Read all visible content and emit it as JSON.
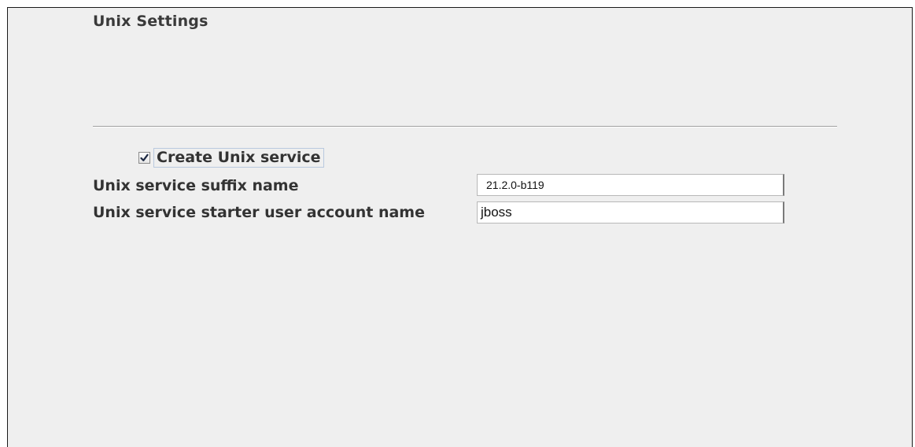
{
  "window": {
    "section_title": "Unix Settings"
  },
  "form": {
    "create_service": {
      "label": "Create Unix service",
      "checked": true
    },
    "suffix": {
      "label": "Unix service suffix name",
      "value": "21.2.0-b119"
    },
    "account": {
      "label": "Unix service starter user account name",
      "value": "jboss"
    }
  },
  "icons": {
    "checkbox_mark": "checkmark-icon"
  }
}
